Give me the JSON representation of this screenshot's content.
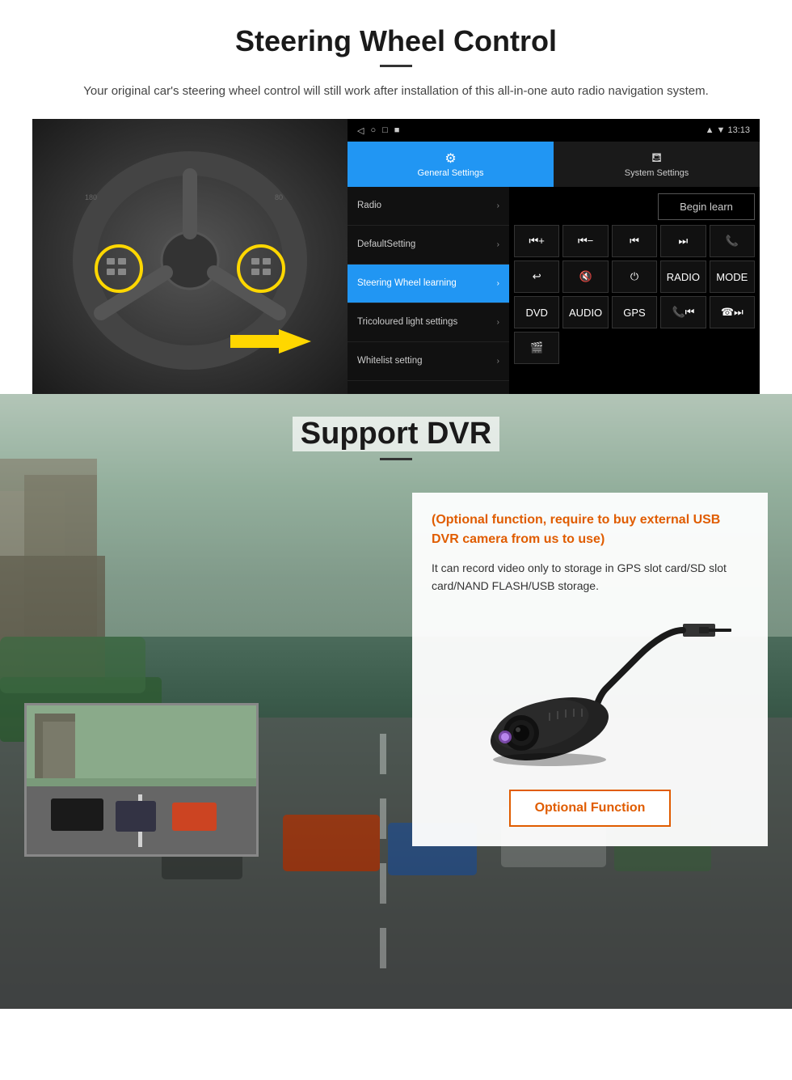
{
  "steering": {
    "title": "Steering Wheel Control",
    "subtitle": "Your original car's steering wheel control will still work after installation of this all-in-one auto radio navigation system.",
    "divider": "",
    "android_ui": {
      "status_time": "13:13",
      "status_icons": [
        "◁",
        "○",
        "□",
        "■"
      ],
      "tab_general_label": "General Settings",
      "tab_system_label": "System Settings",
      "tab_general_icon": "⚙",
      "tab_system_icon": "☎",
      "menu_items": [
        {
          "label": "Radio",
          "active": false
        },
        {
          "label": "DefaultSetting",
          "active": false
        },
        {
          "label": "Steering Wheel learning",
          "active": true
        },
        {
          "label": "Tricoloured light settings",
          "active": false
        },
        {
          "label": "Whitelist setting",
          "active": false
        }
      ],
      "begin_learn": "Begin learn",
      "control_buttons": [
        {
          "label": "⏮+",
          "row": 1
        },
        {
          "label": "⏮-",
          "row": 1
        },
        {
          "label": "⏮",
          "row": 1
        },
        {
          "label": "⏭",
          "row": 1
        },
        {
          "label": "📞",
          "row": 1
        },
        {
          "label": "↩",
          "row": 2
        },
        {
          "label": "🔇",
          "row": 2
        },
        {
          "label": "⏻",
          "row": 2
        },
        {
          "label": "RADIO",
          "row": 2
        },
        {
          "label": "MODE",
          "row": 2
        },
        {
          "label": "DVD",
          "row": 3
        },
        {
          "label": "AUDIO",
          "row": 3
        },
        {
          "label": "GPS",
          "row": 3
        },
        {
          "label": "📞⏮",
          "row": 3
        },
        {
          "label": "☎⏭",
          "row": 3
        },
        {
          "label": "🎬",
          "row": 4
        }
      ]
    }
  },
  "dvr": {
    "title": "Support DVR",
    "optional_text": "(Optional function, require to buy external USB DVR camera from us to use)",
    "desc_text": "It can record video only to storage in GPS slot card/SD slot card/NAND FLASH/USB storage.",
    "optional_btn": "Optional Function"
  }
}
